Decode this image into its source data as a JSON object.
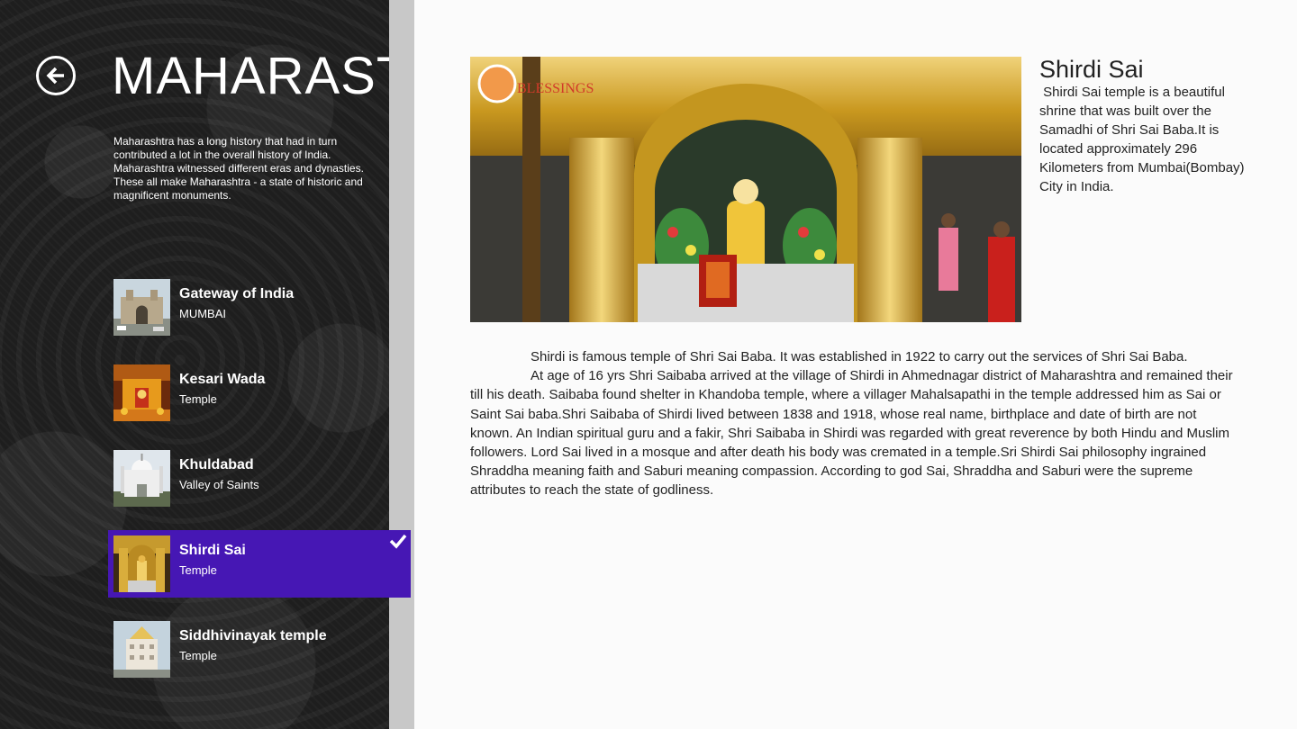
{
  "page": {
    "title": "MAHARASTRA",
    "intro": "Maharashtra has a long history that had in turn contributed a lot in the overall history of India. Maharashtra witnessed different eras and dynasties. These all make Maharashtra - a state of historic and magnificent monuments."
  },
  "icons": {
    "back": "back-arrow-icon",
    "check": "checkmark-icon"
  },
  "colors": {
    "selected": "#4617b4",
    "panel": "#1e1e1e"
  },
  "list": {
    "items": [
      {
        "title": "Gateway of India",
        "subtitle": "MUMBAI",
        "selected": false
      },
      {
        "title": "Kesari Wada",
        "subtitle": "Temple",
        "selected": false
      },
      {
        "title": "Khuldabad",
        "subtitle": "Valley of Saints",
        "selected": false
      },
      {
        "title": "Shirdi Sai",
        "subtitle": "Temple",
        "selected": true
      },
      {
        "title": "Siddhivinayak temple",
        "subtitle": "Temple",
        "selected": false
      }
    ]
  },
  "detail": {
    "title": "Shirdi Sai",
    "summary": "Shirdi Sai temple is a beautiful shrine that was built over the Samadhi of Shri Sai Baba.It is located approximately 296 Kilometers from Mumbai(Bombay) City in India.",
    "paragraph1": "Shirdi is famous temple of Shri Sai Baba. It was established in 1922 to carry out the services of Shri Sai Baba.",
    "paragraph2": "At age of 16 yrs Shri Saibaba arrived at the village of Shirdi in Ahmednagar district of Maharashtra and remained their till his death. Saibaba found shelter in Khandoba temple, where a villager Mahalsapathi in the temple addressed him as Sai or Saint Sai baba.Shri Saibaba of Shirdi lived between 1838 and 1918, whose real name, birthplace and date of birth are not known. An Indian spiritual guru and a fakir, Shri Saibaba in Shirdi was regarded with great reverence by both Hindu and Muslim followers. Lord Sai lived in a mosque and after death his body was cremated in a temple.Sri Shirdi Sai philosophy ingrained Shraddha meaning faith and Saburi meaning compassion. According to god Sai, Shraddha and Saburi were the supreme attributes to reach the state of godliness.",
    "watermark": "BLESSINGS"
  }
}
